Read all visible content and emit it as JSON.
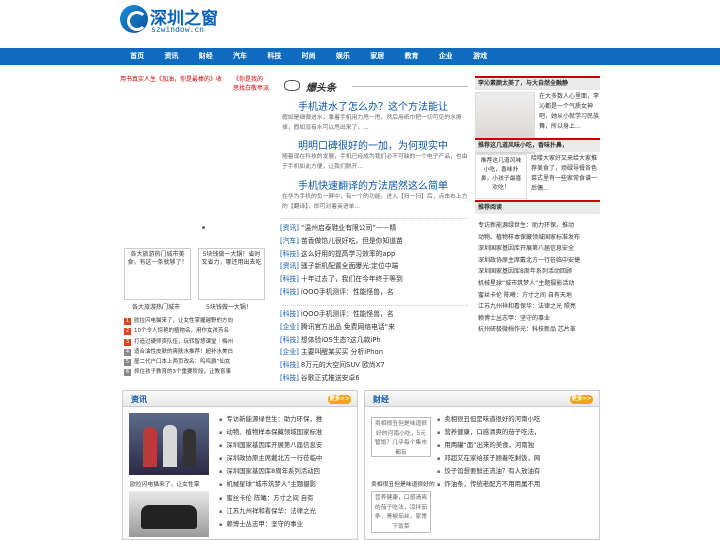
{
  "site": {
    "logo_cn": "深圳之窗",
    "logo_en": "szwindow.cn"
  },
  "nav": [
    "首页",
    "资讯",
    "财经",
    "汽车",
    "科技",
    "时尚",
    "娱乐",
    "家居",
    "教育",
    "企业",
    "游戏"
  ],
  "marquee": {
    "m1": "用书真实人生《加油，你是最棒的》收",
    "m2": "《你是我的",
    "m3": "思找白敬亭派"
  },
  "thumbs": [
    {
      "caption": "各大旅游热门城市美食，有这一条就够了！",
      "label": "各大旅游热门城市"
    },
    {
      "caption": "5块钱做一大锅！省时又省力，哪还用出去吃",
      "label": "5块钱做一大锅！"
    }
  ],
  "rank": [
    "欧拉闪电猫来了，让女性掌握越野的方向",
    "10个令人惊艳的植物名，用作女孩芳名",
    "打造过硬师资队伍，玩转智慧课堂｜梅州",
    "适合油性皮肤的爽肤水推荐！超补水美白",
    "屋二代户口本上两页改名：呜呜爵“仙女",
    "抓住孩子教育的3个重要阶段，让教育事"
  ],
  "blog_label": "爆头条",
  "articles": [
    {
      "title": "手机进水了怎么办？这个方法能让",
      "text": "假如是细微进水，拿着手机用力甩一甩，然后用纸巾把一切可见的水擦掉，假如没有水可以甩出来了，..."
    },
    {
      "title": "明明口碑很好的一加，为何现实中",
      "text": "随着现在科技的发展，手机已经成为我们必不可缺的一个电子产品，也由于手机如此方便，让我们脱开..."
    },
    {
      "title": "手机快速翻译的方法居然这么简单",
      "text": "在华为手机的负一屏中，有一个的功能，进入【扫一扫】后，点击右上方的【翻译】，即可对着英语单..."
    }
  ],
  "news1": [
    {
      "cat": "[资讯]",
      "t": "“温州启泰鞋业有限公司”——精"
    },
    {
      "cat": "[汽车]",
      "t": "苗香做馅儿很好吃，但是你知道苗"
    },
    {
      "cat": "[科技]",
      "t": "这么好用的提高学习效率的app"
    },
    {
      "cat": "[资讯]",
      "t": "骚子新机配置全面曝光:定位中端"
    },
    {
      "cat": "[科技]",
      "t": "十年过去了，我们在今年终于等到"
    },
    {
      "cat": "[科技]",
      "t": "iQOO手机测评：性能怪兽，名"
    }
  ],
  "news2": [
    {
      "cat": "[科技]",
      "t": "iQOO手机测评：性能怪兽，名"
    },
    {
      "cat": "[企业]",
      "t": "腾讯官方出品 免费网络电话“来"
    },
    {
      "cat": "[科技]",
      "t": "想体验iOS生态?这几款iPh"
    },
    {
      "cat": "[企业]",
      "t": "主要叫醒某买买 分析iPhon"
    },
    {
      "cat": "[科技]",
      "t": "8万元的大空间SUV 欧尚X7"
    },
    {
      "cat": "[科技]",
      "t": "谷歌正式推送安卓6"
    }
  ],
  "right": {
    "h1": "李沁素颜太美了，与大自然全融静",
    "t1": "在大多数人心里面，李沁都是一个气质女神吧，她从小就学习民族舞，所以身上...",
    "h2": "推荐这几道风味小吃，香味扑鼻，",
    "img2": "推荐这几道风味小吃，香味扑鼻，小孩子最喜欢吃！",
    "t2": "哈喽大家好又来给大家推荐美食了，烦碌导餐各色菜式里有一些家常食谱一后偶...",
    "h3": "推荐阅读",
    "list": [
      "专访新能源绿世生：助力环保，推动",
      "动物、植物样本保藏领域国家标准发布",
      "深圳国家基因库开展第八届信息安全",
      "深圳政协原主席戴北方一行莅临中安捷",
      "深圳国家基因库8周年系列活动回顾",
      "机械星球“城市筑梦人”主题摄影活动",
      "蜜丝卡伦 陈曦：方寸之间 自有天地",
      "江苏九州祥和看保华：法律之光 照亮",
      "赖博士丛志甲：坚守的事业",
      "杭州研极微档作光：科技新品 芯片革"
    ]
  },
  "sec1": {
    "title": "资讯",
    "more": "更多>>",
    "list": [
      "专访新能源绿世生：助力环保，推",
      "动物、植物样本保藏领域国家标准",
      "深圳国家基因库开展第八届信息安",
      "深圳政协原主席戴北方一行莅临中",
      "深圳国家基因库8周年系列活动回",
      "机械星球“城市筑梦人”主题摄影",
      "蜜丝卡伦 陈曦：方寸之间 自有",
      "江苏九州祥和看保华：法律之光",
      "赖博士丛志甲：坚守的事业"
    ],
    "cap1": "欧拉闪电猫来了，让女性掌"
  },
  "sec2": {
    "title": "财经",
    "more": "更多>>",
    "box1": "卖相很丑但是味道很好的河南小吃，5元管饱？几乎每个集市都有",
    "cap1": "卖相很丑但是味道很好的",
    "box2": "营养健康，口感清爽的茄子吃法，凉拌茄条，青椒茄丝，家常下饭菜",
    "list": [
      "卖相很丑但是味道很好的河南小吃",
      "营养健康，口感清爽的茄子吃法，",
      "用两罐“面”出来的美食，河南独",
      "邓超又在家给孩子顾着吃剩饭，网",
      "饺子馅想要鲜还流油？有人放油有",
      "炸油条，传统老配方不用用属不用"
    ]
  }
}
